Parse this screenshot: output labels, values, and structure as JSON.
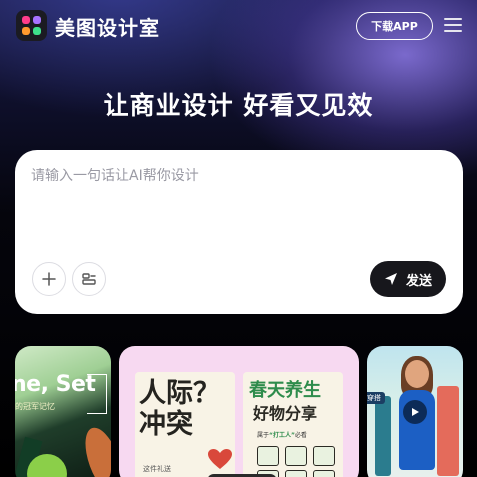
{
  "header": {
    "brand": "美图设计室",
    "download_label": "下载APP"
  },
  "hero": {
    "headline": "让商业设计 好看又见效"
  },
  "prompt": {
    "placeholder": "请输入一句话让AI帮你设计",
    "send_label": "发送"
  },
  "gallery": {
    "card1": {
      "title": "ne, Set",
      "subtitle": "的冠军记忆"
    },
    "card2": {
      "panel1_title": "人际？冲突",
      "panel1_fine": "这件礼送",
      "panel2_title": "春天养生",
      "panel2_sub": "好物分享",
      "panel2_tag_prefix": "属于",
      "panel2_tag_mid": "“打工人”",
      "panel2_tag_suffix": "必看"
    },
    "card3": {
      "label": "穿搭"
    }
  },
  "colors": {
    "accent_dark": "#17171c",
    "headline": "#ffffff",
    "card_bg": "#ffffff"
  },
  "icons": [
    "app-logo-icon",
    "menu-icon",
    "plus-icon",
    "tools-icon",
    "send-icon",
    "play-icon"
  ]
}
